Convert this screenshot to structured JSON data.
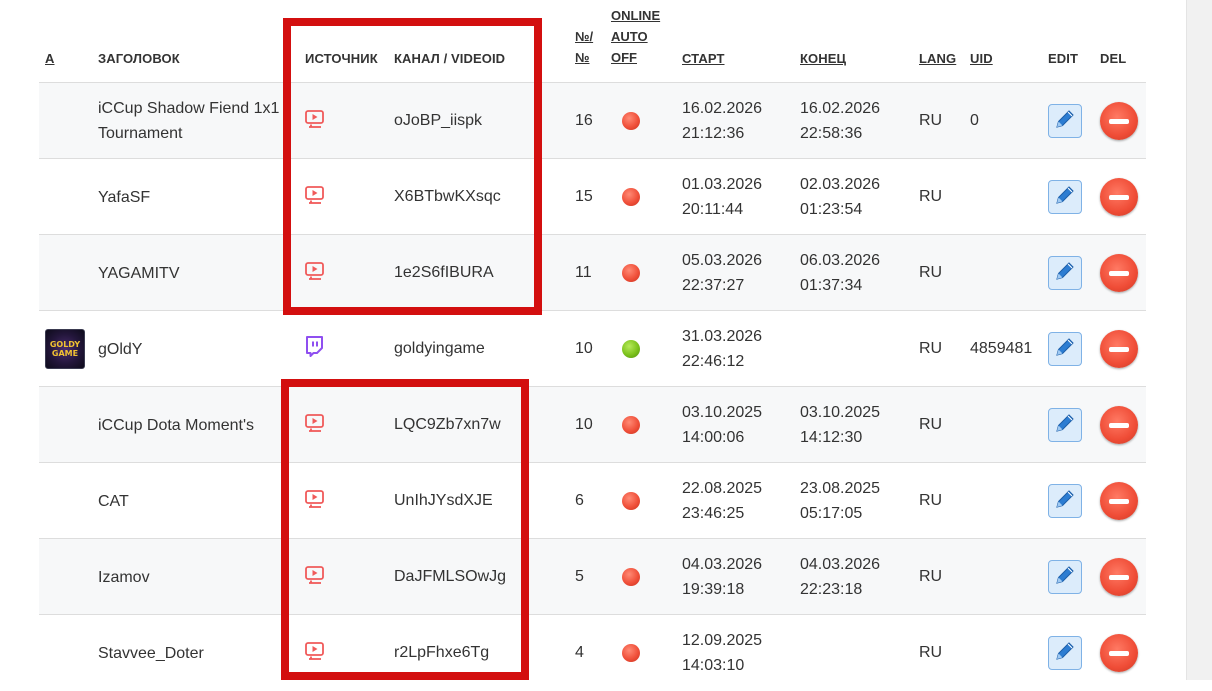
{
  "header": {
    "col_a": "A",
    "col_title": "ЗАГОЛОВОК",
    "col_source": "ИСТОЧНИК",
    "col_channel": "КАНАЛ / VIDEOID",
    "col_num_top": "№/",
    "col_num_bottom": "№",
    "col_online_1": "ONLINE",
    "col_online_2": "AUTO",
    "col_online_3": "OFF",
    "col_start": "СТАРТ",
    "col_end": "КОНЕЦ",
    "col_lang": "LANG",
    "col_uid": "UID",
    "col_edit": "EDIT",
    "col_del": "DEL"
  },
  "rows": [
    {
      "title_1": "iCCup Shadow Fiend 1x1",
      "title_2": "Tournament",
      "source_icon": "youtube-icon",
      "channel": "oJoBP_iispk",
      "num": "16",
      "online": "off",
      "start_date": "16.02.2026",
      "start_time": "21:12:36",
      "end_date": "16.02.2026",
      "end_time": "22:58:36",
      "lang": "RU",
      "uid": "0"
    },
    {
      "title_1": "YafaSF",
      "title_2": "",
      "source_icon": "youtube-icon",
      "channel": "X6BTbwKXsqc",
      "num": "15",
      "online": "off",
      "start_date": "01.03.2026",
      "start_time": "20:11:44",
      "end_date": "02.03.2026",
      "end_time": "01:23:54",
      "lang": "RU",
      "uid": ""
    },
    {
      "title_1": "YAGAMITV",
      "title_2": "",
      "source_icon": "youtube-icon",
      "channel": "1e2S6fIBURA",
      "num": "11",
      "online": "off",
      "start_date": "05.03.2026",
      "start_time": "22:37:27",
      "end_date": "06.03.2026",
      "end_time": "01:37:34",
      "lang": "RU",
      "uid": ""
    },
    {
      "title_1": "gOldY",
      "title_2": "",
      "source_icon": "twitch-icon",
      "channel": "goldyingame",
      "num": "10",
      "online": "on",
      "start_date": "31.03.2026",
      "start_time": "22:46:12",
      "end_date": "",
      "end_time": "",
      "lang": "RU",
      "uid": "4859481",
      "avatar_text": "GOLDY GAME"
    },
    {
      "title_1": "iCCup Dota Moment's",
      "title_2": "",
      "source_icon": "youtube-icon",
      "channel": "LQC9Zb7xn7w",
      "num": "10",
      "online": "off",
      "start_date": "03.10.2025",
      "start_time": "14:00:06",
      "end_date": "03.10.2025",
      "end_time": "14:12:30",
      "lang": "RU",
      "uid": ""
    },
    {
      "title_1": "CAT",
      "title_2": "",
      "source_icon": "youtube-icon",
      "channel": "UnIhJYsdXJE",
      "num": "6",
      "online": "off",
      "start_date": "22.08.2025",
      "start_time": "23:46:25",
      "end_date": "23.08.2025",
      "end_time": "05:17:05",
      "lang": "RU",
      "uid": ""
    },
    {
      "title_1": "Izamov",
      "title_2": "",
      "source_icon": "youtube-icon",
      "channel": "DaJFMLSOwJg",
      "num": "5",
      "online": "off",
      "start_date": "04.03.2026",
      "start_time": "19:39:18",
      "end_date": "04.03.2026",
      "end_time": "22:23:18",
      "lang": "RU",
      "uid": ""
    },
    {
      "title_1": "Stavvee_Doter",
      "title_2": "",
      "source_icon": "youtube-icon",
      "channel": "r2LpFhxe6Tg",
      "num": "4",
      "online": "off",
      "start_date": "12.09.2025",
      "start_time": "14:03:10",
      "end_date": "",
      "end_time": "",
      "lang": "RU",
      "uid": ""
    }
  ],
  "colors": {
    "highlight_box": "#d30f0f",
    "online_on": "#7cc21c",
    "online_off": "#f0503a",
    "youtube_icon": "#f05a5a",
    "twitch_icon": "#8f4ff0"
  }
}
